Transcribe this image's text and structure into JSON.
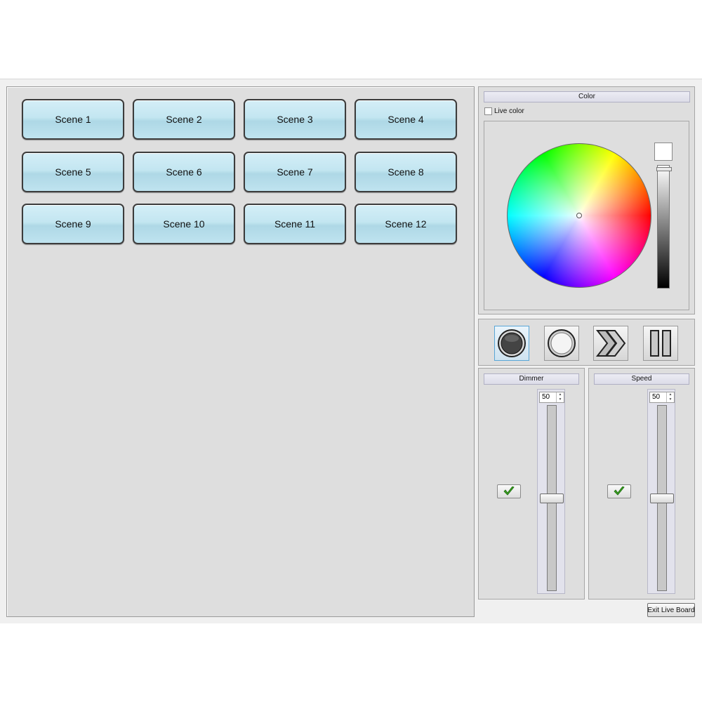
{
  "scenes": [
    "Scene 1",
    "Scene 2",
    "Scene 3",
    "Scene 4",
    "Scene 5",
    "Scene 6",
    "Scene 7",
    "Scene 8",
    "Scene 9",
    "Scene 10",
    "Scene 11",
    "Scene 12"
  ],
  "color": {
    "title": "Color",
    "live_color_label": "Live color",
    "live_color_checked": false,
    "current_color": "#ffffff"
  },
  "modes": [
    {
      "icon": "record-icon",
      "active": true
    },
    {
      "icon": "stop-icon",
      "active": false
    },
    {
      "icon": "fast-forward-icon",
      "active": false
    },
    {
      "icon": "pause-icon",
      "active": false
    }
  ],
  "dimmer": {
    "title": "Dimmer",
    "value": "50",
    "enabled": true,
    "level_percent": 50
  },
  "speed": {
    "title": "Speed",
    "value": "50",
    "enabled": true,
    "level_percent": 50
  },
  "exit_button": {
    "label": "Exit Live Board"
  }
}
